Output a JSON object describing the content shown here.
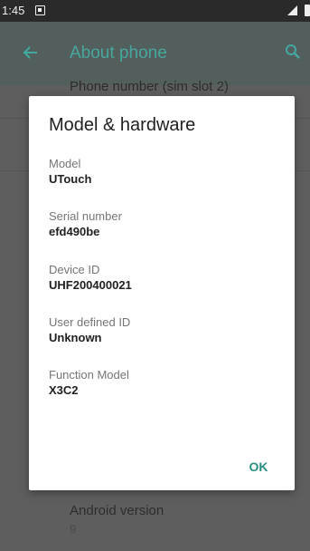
{
  "status_bar": {
    "time": "1:45"
  },
  "app_bar": {
    "title": "About phone",
    "back_icon": "arrow-left-icon",
    "search_icon": "search-icon",
    "accent_color": "#48a79d"
  },
  "background_list": {
    "partial_item": "Phone number (sim slot 2)",
    "bottom_item": {
      "title": "Android version",
      "value": "9"
    }
  },
  "dialog": {
    "title": "Model & hardware",
    "fields": [
      {
        "label": "Model",
        "value": "UTouch"
      },
      {
        "label": "Serial number",
        "value": "efd490be"
      },
      {
        "label": "Device ID",
        "value": "UHF200400021"
      },
      {
        "label": "User defined ID",
        "value": "Unknown"
      },
      {
        "label": "Function Model",
        "value": "X3C2"
      }
    ],
    "ok_label": "OK",
    "ok_color": "#2a8e82"
  }
}
